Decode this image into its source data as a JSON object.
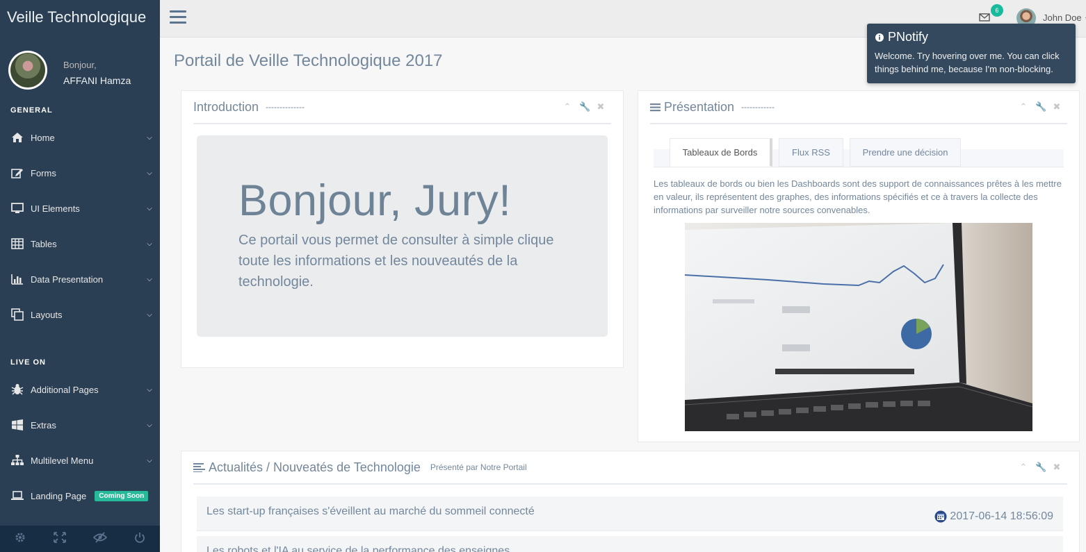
{
  "app": {
    "title": "Veille Technologique"
  },
  "profile": {
    "greeting": "Bonjour,",
    "name": "AFFANI Hamza"
  },
  "sidebar": {
    "section_general": "GENERAL",
    "section_live": "LIVE ON",
    "items": [
      {
        "label": "Home",
        "icon": "home-icon"
      },
      {
        "label": "Forms",
        "icon": "edit-icon"
      },
      {
        "label": "UI Elements",
        "icon": "desktop-icon"
      },
      {
        "label": "Tables",
        "icon": "table-icon"
      },
      {
        "label": "Data Presentation",
        "icon": "bar-chart-icon"
      },
      {
        "label": "Layouts",
        "icon": "clone-icon"
      }
    ],
    "live_items": [
      {
        "label": "Additional Pages",
        "icon": "bug-icon"
      },
      {
        "label": "Extras",
        "icon": "windows-icon"
      },
      {
        "label": "Multilevel Menu",
        "icon": "sitemap-icon"
      },
      {
        "label": "Landing Page",
        "icon": "laptop-icon",
        "badge": "Coming Soon"
      }
    ],
    "footer": [
      "settings-icon",
      "fullscreen-icon",
      "lock-icon",
      "logout-icon"
    ]
  },
  "topnav": {
    "mail_count": "6",
    "user_name": "John Doe"
  },
  "page": {
    "title": "Portail de Veille Technologique 2017"
  },
  "intro_panel": {
    "title": "Introduction",
    "subtitle": "--------------",
    "heading": "Bonjour, Jury!",
    "text": "Ce portail vous permet de consulter à simple clique toute les informations et les nouveautés de la technologie."
  },
  "presentation_panel": {
    "title": "Présentation",
    "subtitle": "------------",
    "tabs": [
      "Tableaux de Bords",
      "Flux RSS",
      "Prendre une décision"
    ],
    "active_tab": "Tableaux de Bords",
    "text": "Les tableaux de bords ou bien les Dashboards sont des support de connaissances prêtes à les mettre en valeur, ils représentent des graphes, des informations spécifiés et ce à travers la collecte des informations par surveiller notre sources convenables."
  },
  "news_panel": {
    "title": "Actualités / Nouveatés de Technologie",
    "subtitle": "Présenté par Notre Portail",
    "rows": [
      {
        "title": "Les start-up françaises s'éveillent au marché du sommeil connecté",
        "date": "2017-06-14 18:56:09"
      },
      {
        "title": "Les robots et l'IA au service de la performance des enseignes",
        "date": ""
      }
    ]
  },
  "pnotify": {
    "title": "PNotify",
    "text": "Welcome. Try hovering over me. You can click things behind me, because I'm non-blocking."
  },
  "colors": {
    "sidebar": "#2A3F54",
    "accent": "#1ABB9C",
    "badge": "#26B99A",
    "notify": "#34495E"
  }
}
